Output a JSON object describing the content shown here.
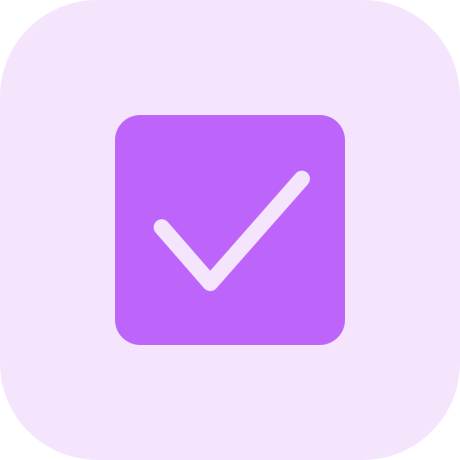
{
  "icon": {
    "name": "checkbox-checked-icon",
    "state": "checked",
    "colors": {
      "tile_background": "#f4e5fd",
      "checkbox_fill": "#bd65fb",
      "checkmark_stroke": "#f4e5fd"
    }
  }
}
